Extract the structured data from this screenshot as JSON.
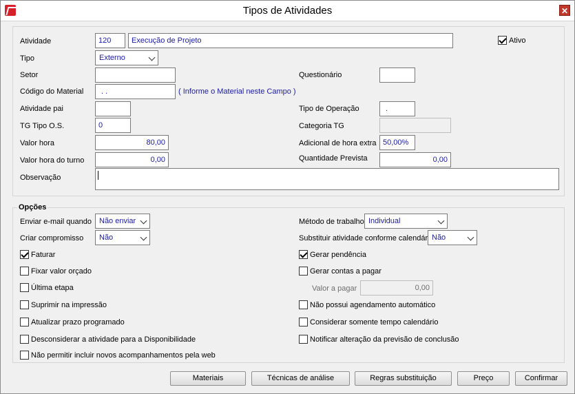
{
  "window": {
    "title": "Tipos de Atividades"
  },
  "form": {
    "atividade_label": "Atividade",
    "atividade_code": "120",
    "atividade_name": "Execução de Projeto",
    "ativo_label": "Ativo",
    "ativo_checked": true,
    "tipo_label": "Tipo",
    "tipo_value": "Externo",
    "setor_label": "Setor",
    "questionario_label": "Questionário",
    "codigo_material_label": "Código do Material",
    "codigo_material_value": ". .",
    "codigo_material_hint": "( Informe o Material neste Campo )",
    "atividade_pai_label": "Atividade pai",
    "tipo_operacao_label": "Tipo de Operação",
    "tipo_operacao_value": ".",
    "tg_tipo_os_label": "TG Tipo O.S.",
    "tg_tipo_os_value": "0",
    "categoria_tg_label": "Categoria TG",
    "valor_hora_label": "Valor hora",
    "valor_hora_value": "80,00",
    "adicional_label": "Adicional de hora extra",
    "adicional_value": "50,00%",
    "valor_hora_turno_label": "Valor hora do turno",
    "valor_hora_turno_value": "0,00",
    "quantidade_prevista_label": "Quantidade Prevista",
    "quantidade_prevista_value": "0,00",
    "observacao_label": "Observação"
  },
  "opcoes": {
    "title": "Opções",
    "enviar_email_label": "Enviar e-mail quando",
    "enviar_email_value": "Não enviar",
    "metodo_label": "Método de trabalho",
    "metodo_value": "Individual",
    "criar_compromisso_label": "Criar compromisso",
    "criar_compromisso_value": "Não",
    "substituir_label": "Substituir atividade conforme calendário",
    "substituir_value": "Não",
    "checks_left": [
      {
        "label": "Faturar",
        "checked": true
      },
      {
        "label": "Fixar valor orçado",
        "checked": false
      },
      {
        "label": "Última etapa",
        "checked": false
      },
      {
        "label": "Suprimir na impressão",
        "checked": false
      },
      {
        "label": "Atualizar prazo programado",
        "checked": false
      },
      {
        "label": "Desconsiderar a atividade para a Disponibilidade",
        "checked": false
      },
      {
        "label": "Não permitir incluir novos acompanhamentos pela web",
        "checked": false
      }
    ],
    "checks_right": [
      {
        "label": "Gerar pendência",
        "checked": true
      },
      {
        "label": "Gerar contas a pagar",
        "checked": false
      },
      {
        "label": "Não possui agendamento automático",
        "checked": false
      },
      {
        "label": "Considerar somente tempo calendário",
        "checked": false
      },
      {
        "label": "Notificar alteração da previsão de conclusão",
        "checked": false
      }
    ],
    "valor_pagar_label": "Valor a pagar",
    "valor_pagar_value": "0,00"
  },
  "buttons": {
    "materiais": "Materiais",
    "tecnicas": "Técnicas de análise",
    "regras": "Regras substituição",
    "preco": "Preço",
    "confirmar": "Confirmar"
  }
}
